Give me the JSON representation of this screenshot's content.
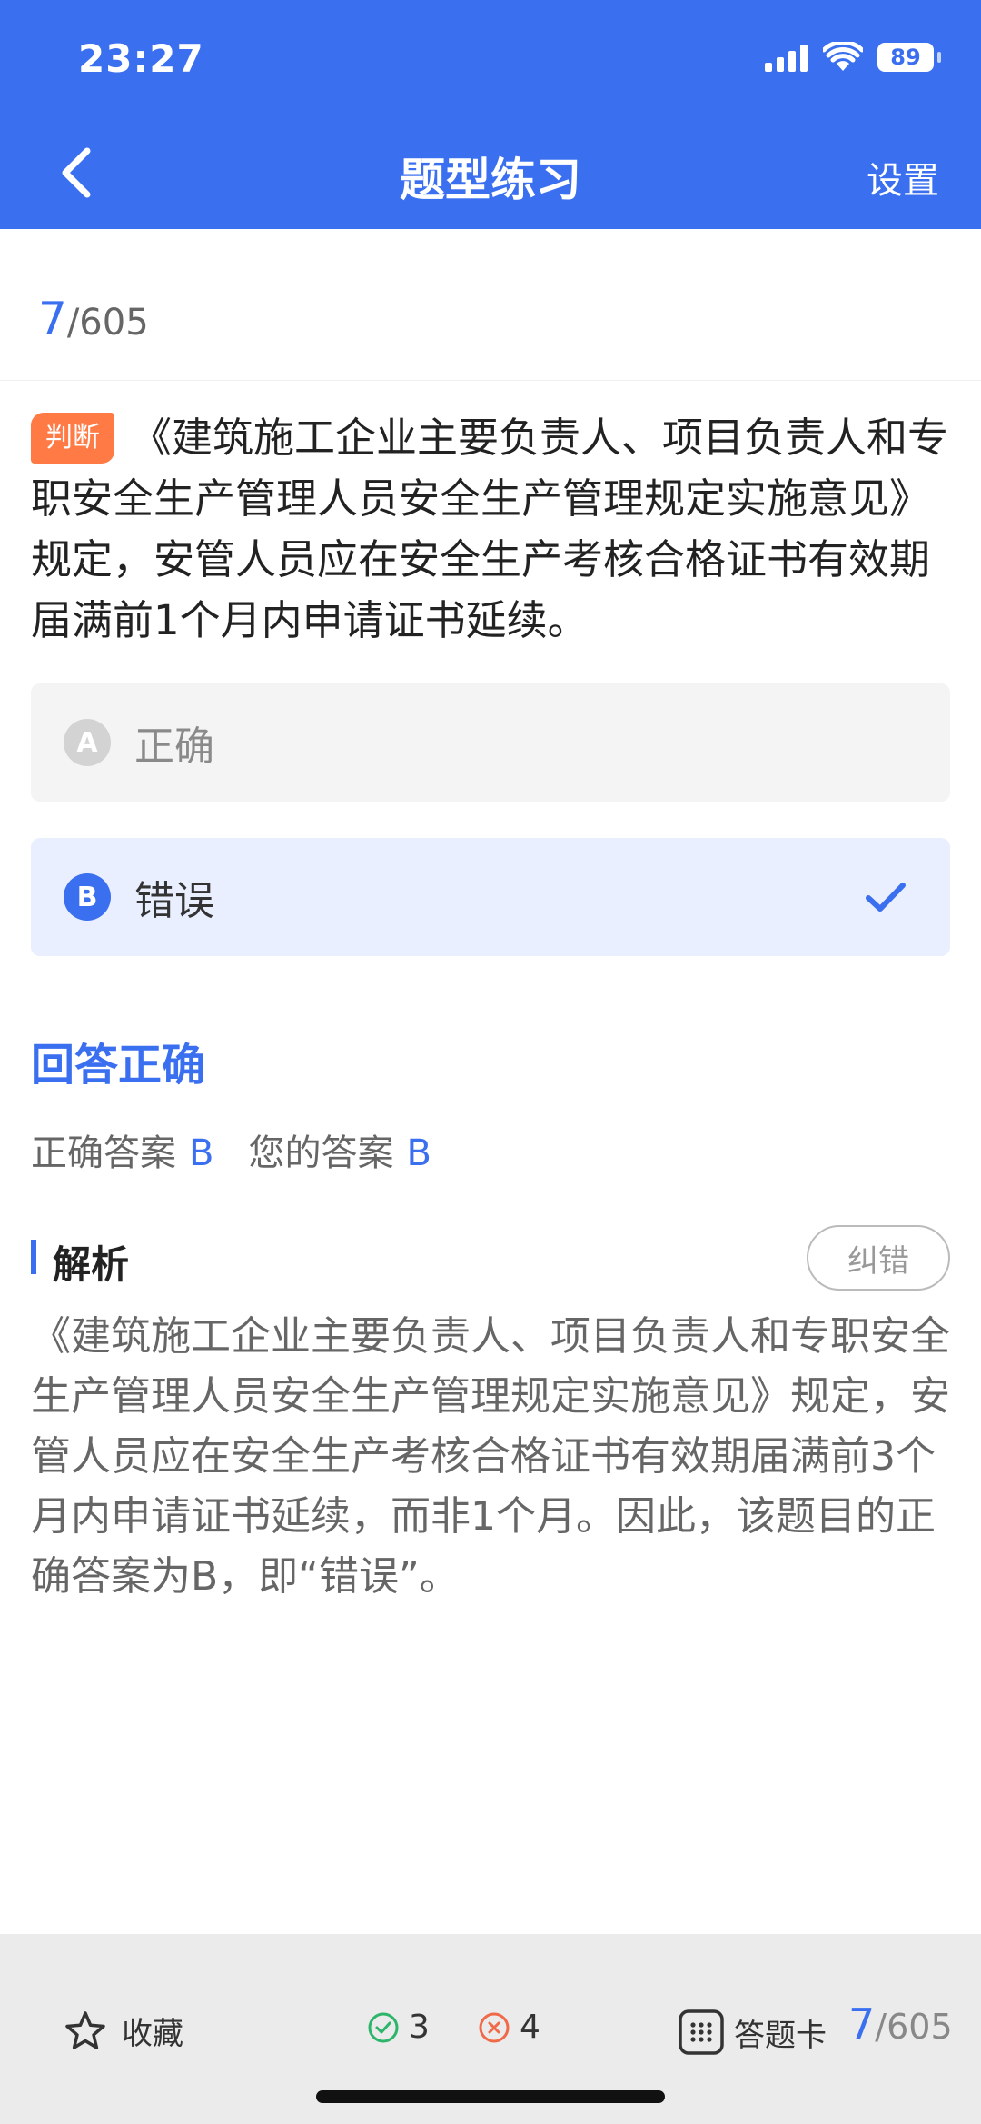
{
  "status_bar": {
    "time": "23:27",
    "battery": "89"
  },
  "nav": {
    "title": "题型练习",
    "settings_label": "设置"
  },
  "progress": {
    "current": "7",
    "total": "/605"
  },
  "question": {
    "type": "判断",
    "text": "《建筑施工企业主要负责人、项目负责人和专职安全生产管理人员安全生产管理规定实施意见》规定，安管人员应在安全生产考核合格证书有效期届满前1个月内申请证书延续。"
  },
  "options": [
    {
      "letter": "A",
      "text": "正确",
      "selected": false
    },
    {
      "letter": "B",
      "text": "错误",
      "selected": true
    }
  ],
  "result": {
    "title": "回答正确",
    "correct_label": "正确答案",
    "correct_value": "B",
    "your_label": "您的答案",
    "your_value": "B"
  },
  "analysis": {
    "title": "解析",
    "report_label": "纠错",
    "text": "《建筑施工企业主要负责人、项目负责人和专职安全生产管理人员安全生产管理规定实施意见》规定，安管人员应在安全生产考核合格证书有效期届满前3个月内申请证书延续，而非1个月。因此，该题目的正确答案为B，即“错误”。"
  },
  "bottom_bar": {
    "favorite_label": "收藏",
    "right_count": "3",
    "wrong_count": "4",
    "card_label": "答题卡",
    "current": "7",
    "total": "/605"
  },
  "colors": {
    "primary": "#3a6ff0",
    "tag": "#ff7a45",
    "correct": "#2db56a",
    "wrong": "#f06a4a"
  }
}
